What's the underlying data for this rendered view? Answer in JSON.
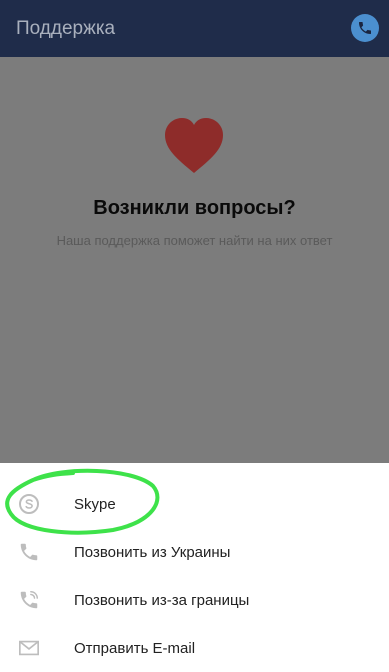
{
  "appbar": {
    "title": "Поддержка",
    "icon": "phone-icon",
    "colors": {
      "bar": "#1f2c4a",
      "button": "#4b8fcf"
    }
  },
  "hero": {
    "icon": "heart-icon",
    "heart_color": "#8e2c2a",
    "title": "Возникли вопросы?",
    "subtitle": "Наша поддержка поможет найти на них ответ"
  },
  "sheet": {
    "items": [
      {
        "label": "Skype",
        "icon": "skype-icon"
      },
      {
        "label": "Позвонить из Украины",
        "icon": "phone-icon"
      },
      {
        "label": "Позвонить из-за границы",
        "icon": "phone-forward-icon"
      },
      {
        "label": "Отправить E-mail",
        "icon": "email-icon"
      }
    ]
  },
  "annotation": {
    "color": "#3ee24a"
  }
}
